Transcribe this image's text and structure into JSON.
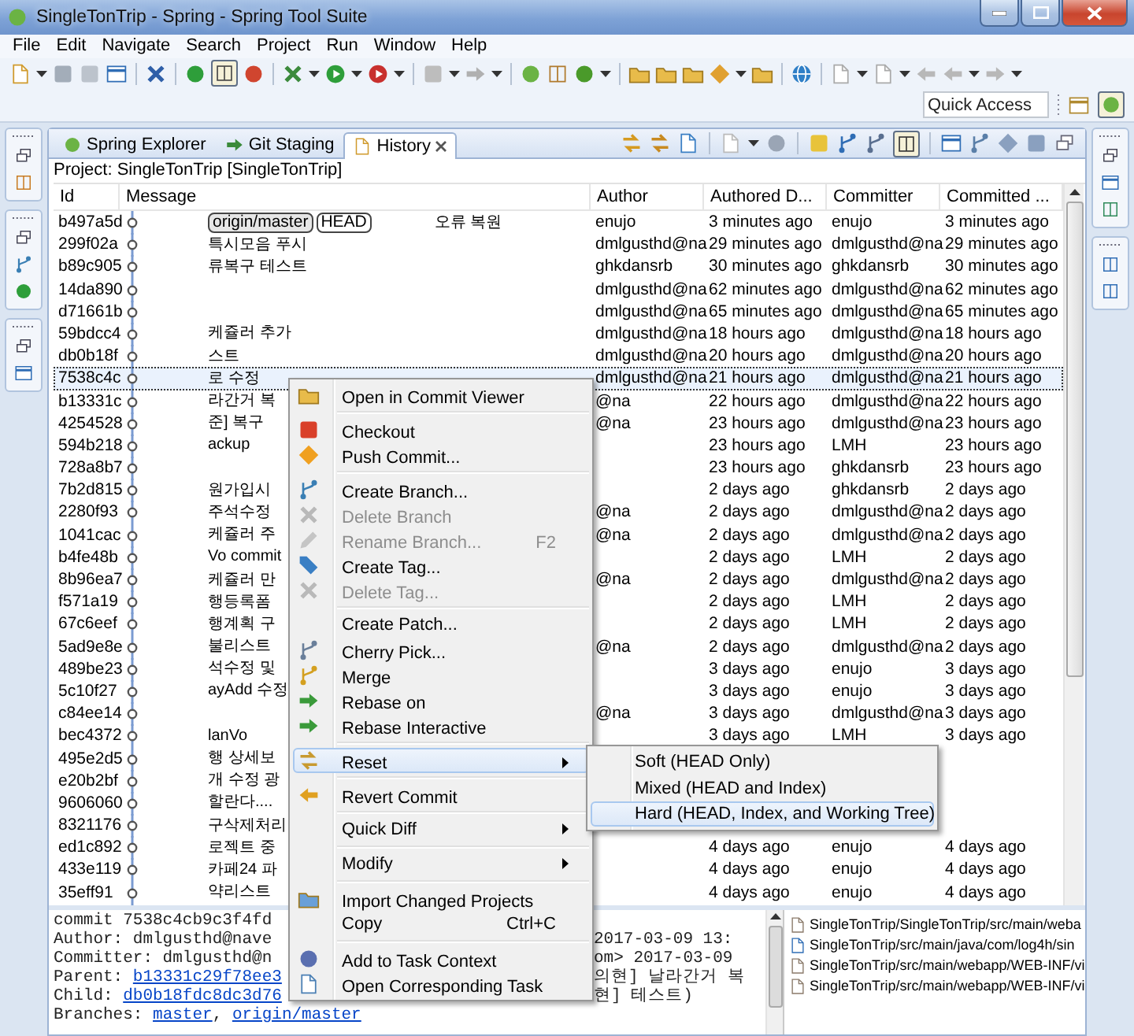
{
  "window": {
    "title": "SingleTonTrip - Spring - Spring Tool Suite"
  },
  "menu_bar": [
    "File",
    "Edit",
    "Navigate",
    "Search",
    "Project",
    "Run",
    "Window",
    "Help"
  ],
  "quick_access": {
    "placeholder": "Quick Access"
  },
  "view_tabs": [
    {
      "label": "Spring Explorer",
      "selected": false,
      "closable": false
    },
    {
      "label": "Git Staging",
      "selected": false,
      "closable": false
    },
    {
      "label": "History",
      "selected": true,
      "closable": true
    }
  ],
  "project_label": "Project: SingleTonTrip [SingleTonTrip]",
  "history_table": {
    "columns": [
      "Id",
      "Message",
      "Author",
      "Authored D...",
      "Committer",
      "Committed ..."
    ],
    "rows": [
      {
        "id": "b497a5d",
        "tags": [
          {
            "label": "origin/master",
            "kind": "remote"
          },
          {
            "label": "HEAD",
            "kind": "head"
          }
        ],
        "message": "오류 복원",
        "author": "enujo",
        "authored": "3 minutes ago",
        "committer": "enujo",
        "committed": "3 minutes ago",
        "selected": false
      },
      {
        "id": "299f02a",
        "message": "특시모음 푸시",
        "author": "dmlgusthd@na",
        "authored": "29 minutes ago",
        "committer": "dmlgusthd@na",
        "committed": "29 minutes ago",
        "selected": false
      },
      {
        "id": "b89c905",
        "message": "류복구 테스트",
        "author": "ghkdansrb",
        "authored": "30 minutes ago",
        "committer": "ghkdansrb",
        "committed": "30 minutes ago",
        "selected": false
      },
      {
        "id": "14da890",
        "author": "dmlgusthd@na",
        "authored": "62 minutes ago",
        "committer": "dmlgusthd@na",
        "committed": "62 minutes ago",
        "selected": false
      },
      {
        "id": "d71661b",
        "author": "dmlgusthd@na",
        "authored": "65 minutes ago",
        "committer": "dmlgusthd@na",
        "committed": "65 minutes ago",
        "selected": false
      },
      {
        "id": "59bdcc4",
        "message": "케쥴러 추가",
        "author": "dmlgusthd@na",
        "authored": "18 hours ago",
        "committer": "dmlgusthd@na",
        "committed": "18 hours ago",
        "selected": false
      },
      {
        "id": "db0b18f",
        "message": "스트",
        "author": "dmlgusthd@na",
        "authored": "20 hours ago",
        "committer": "dmlgusthd@na",
        "committed": "20 hours ago",
        "selected": false
      },
      {
        "id": "7538c4c",
        "message": "로 수정",
        "author": "dmlgusthd@na",
        "authored": "21 hours ago",
        "committer": "dmlgusthd@na",
        "committed": "21 hours ago",
        "selected": true
      },
      {
        "id": "b13331c",
        "message": "라간거 복",
        "author": "@na",
        "authored": "22 hours ago",
        "committer": "dmlgusthd@na",
        "committed": "22 hours ago",
        "selected": false
      },
      {
        "id": "4254528",
        "message": "준] 복구",
        "author": "@na",
        "authored": "23 hours ago",
        "committer": "dmlgusthd@na",
        "committed": "23 hours ago",
        "selected": false
      },
      {
        "id": "594b218",
        "message": "ackup",
        "authored": "23 hours ago",
        "committer": "LMH",
        "committed": "23 hours ago",
        "selected": false
      },
      {
        "id": "728a8b7",
        "authored": "23 hours ago",
        "committer": "ghkdansrb",
        "committed": "23 hours ago",
        "selected": false
      },
      {
        "id": "7b2d815",
        "message": "원가입시",
        "authored": "2 days ago",
        "committer": "ghkdansrb",
        "committed": "2 days ago",
        "selected": false
      },
      {
        "id": "2280f93",
        "message": "주석수정",
        "author": "@na",
        "authored": "2 days ago",
        "committer": "dmlgusthd@na",
        "committed": "2 days ago",
        "selected": false
      },
      {
        "id": "1041cac",
        "message": "케쥴러 주",
        "author": "@na",
        "authored": "2 days ago",
        "committer": "dmlgusthd@na",
        "committed": "2 days ago",
        "selected": false
      },
      {
        "id": "b4fe48b",
        "message": "Vo commit",
        "authored": "2 days ago",
        "committer": "LMH",
        "committed": "2 days ago",
        "selected": false
      },
      {
        "id": "8b96ea7",
        "message": "케쥴러 만",
        "author": "@na",
        "authored": "2 days ago",
        "committer": "dmlgusthd@na",
        "committed": "2 days ago",
        "selected": false
      },
      {
        "id": "f571a19",
        "message": "행등록폼",
        "authored": "2 days ago",
        "committer": "LMH",
        "committed": "2 days ago",
        "selected": false
      },
      {
        "id": "67c6eef",
        "message": "행계획 구",
        "authored": "2 days ago",
        "committer": "LMH",
        "committed": "2 days ago",
        "selected": false
      },
      {
        "id": "5ad9e8e",
        "message": "불리스트",
        "author": "@na",
        "authored": "2 days ago",
        "committer": "dmlgusthd@na",
        "committed": "2 days ago",
        "selected": false
      },
      {
        "id": "489be23",
        "message": "석수정 및",
        "authored": "3 days ago",
        "committer": "enujo",
        "committed": "3 days ago",
        "selected": false
      },
      {
        "id": "5c10f27",
        "message": "ayAdd 수정",
        "authored": "3 days ago",
        "committer": "enujo",
        "committed": "3 days ago",
        "selected": false
      },
      {
        "id": "c84ee14",
        "author": "@na",
        "authored": "3 days ago",
        "committer": "dmlgusthd@na",
        "committed": "3 days ago",
        "selected": false
      },
      {
        "id": "bec4372",
        "message": "lanVo",
        "authored": "3 days ago",
        "committer": "LMH",
        "committed": "3 days ago",
        "selected": false
      },
      {
        "id": "495e2d5",
        "message": "행 상세보",
        "selected": false
      },
      {
        "id": "e20b2bf",
        "message": "개 수정 광",
        "selected": false
      },
      {
        "id": "9606060",
        "message": "할란다....",
        "selected": false
      },
      {
        "id": "8321176",
        "message": "구삭제처리",
        "selected": false
      },
      {
        "id": "ed1c892",
        "message": "로젝트 중",
        "authored": "4 days ago",
        "committer": "enujo",
        "committed": "4 days ago",
        "selected": false
      },
      {
        "id": "433e119",
        "message": "카페24 파",
        "authored": "4 days ago",
        "committer": "enujo",
        "committed": "4 days ago",
        "selected": false
      },
      {
        "id": "35eff91",
        "message": "약리스트",
        "authored": "4 days ago",
        "committer": "enujo",
        "committed": "4 days ago",
        "selected": false
      }
    ]
  },
  "commit_details": {
    "lines": [
      {
        "left": [
          {
            "text": "commit 7538c4cb9c3f4fd",
            "link": false
          }
        ]
      },
      {
        "left": [
          {
            "text": "Author: dmlgusthd@nave",
            "link": false
          }
        ],
        "right": "2017-03-09 13:"
      },
      {
        "left": [
          {
            "text": "Committer: dmlgusthd@n",
            "link": false
          }
        ],
        "right": "om> 2017-03-09"
      },
      {
        "left": [
          {
            "text": "Parent: ",
            "link": false
          },
          {
            "text": "b13331c29f78ee3",
            "link": true
          }
        ],
        "right": "의현] 날라간거 복"
      },
      {
        "left": [
          {
            "text": "Child: ",
            "link": false
          },
          {
            "text": "db0b18fdc8dc3d76",
            "link": true
          }
        ],
        "right": "현] 테스트)"
      },
      {
        "left": [
          {
            "text": "Branches: ",
            "link": false
          },
          {
            "text": "master",
            "link": true
          },
          {
            "text": ", ",
            "link": false
          },
          {
            "text": "origin/master",
            "link": true
          }
        ]
      }
    ]
  },
  "changed_files": [
    "SingleTonTrip/SingleTonTrip/src/main/weba",
    "SingleTonTrip/src/main/java/com/log4h/sin",
    "SingleTonTrip/src/main/webapp/WEB-INF/vi",
    "SingleTonTrip/src/main/webapp/WEB-INF/vi"
  ],
  "context_menu": {
    "items": [
      {
        "kind": "item",
        "label": "Open in Commit Viewer",
        "disabled": false,
        "submenu": false,
        "selected": false
      },
      {
        "kind": "separator"
      },
      {
        "kind": "item",
        "label": "Checkout",
        "disabled": false,
        "submenu": false,
        "selected": false
      },
      {
        "kind": "item",
        "label": "Push Commit...",
        "disabled": false,
        "submenu": false,
        "selected": false
      },
      {
        "kind": "separator"
      },
      {
        "kind": "item",
        "label": "Create Branch...",
        "disabled": false,
        "submenu": false,
        "selected": false
      },
      {
        "kind": "item",
        "label": "Delete Branch",
        "disabled": true,
        "submenu": false,
        "selected": false
      },
      {
        "kind": "item",
        "label": "Rename Branch...",
        "shortcut": "F2",
        "disabled": true,
        "submenu": false,
        "selected": false
      },
      {
        "kind": "item",
        "label": "Create Tag...",
        "disabled": false,
        "submenu": false,
        "selected": false
      },
      {
        "kind": "item",
        "label": "Delete Tag...",
        "disabled": true,
        "submenu": false,
        "selected": false
      },
      {
        "kind": "separator"
      },
      {
        "kind": "item",
        "label": "Create Patch...",
        "disabled": false,
        "submenu": false,
        "selected": false
      },
      {
        "kind": "item",
        "label": "Cherry Pick...",
        "disabled": false,
        "submenu": false,
        "selected": false
      },
      {
        "kind": "item",
        "label": "Merge",
        "disabled": false,
        "submenu": false,
        "selected": false
      },
      {
        "kind": "item",
        "label": "Rebase on",
        "disabled": false,
        "submenu": false,
        "selected": false
      },
      {
        "kind": "item",
        "label": "Rebase Interactive",
        "disabled": false,
        "submenu": false,
        "selected": false
      },
      {
        "kind": "separator"
      },
      {
        "kind": "item",
        "label": "Reset",
        "disabled": false,
        "submenu": true,
        "selected": true
      },
      {
        "kind": "separator"
      },
      {
        "kind": "item",
        "label": "Revert Commit",
        "disabled": false,
        "submenu": false,
        "selected": false
      },
      {
        "kind": "separator"
      },
      {
        "kind": "item",
        "label": "Quick Diff",
        "disabled": false,
        "submenu": true,
        "selected": false
      },
      {
        "kind": "separator"
      },
      {
        "kind": "item",
        "label": "Modify",
        "disabled": false,
        "submenu": true,
        "selected": false
      },
      {
        "kind": "separator"
      },
      {
        "kind": "item",
        "label": "Import Changed Projects",
        "disabled": false,
        "submenu": false,
        "selected": false
      },
      {
        "kind": "item",
        "label": "Copy",
        "shortcut": "Ctrl+C",
        "disabled": false,
        "submenu": false,
        "selected": false
      },
      {
        "kind": "separator"
      },
      {
        "kind": "item",
        "label": "Add to Task Context",
        "disabled": false,
        "submenu": false,
        "selected": false
      },
      {
        "kind": "item",
        "label": "Open Corresponding Task",
        "disabled": false,
        "submenu": false,
        "selected": false
      }
    ]
  },
  "reset_submenu": {
    "items": [
      {
        "label": "Soft (HEAD Only)",
        "selected": false
      },
      {
        "label": "Mixed (HEAD and Index)",
        "selected": false
      },
      {
        "label": "Hard (HEAD, Index, and Working Tree)",
        "selected": true
      }
    ]
  }
}
